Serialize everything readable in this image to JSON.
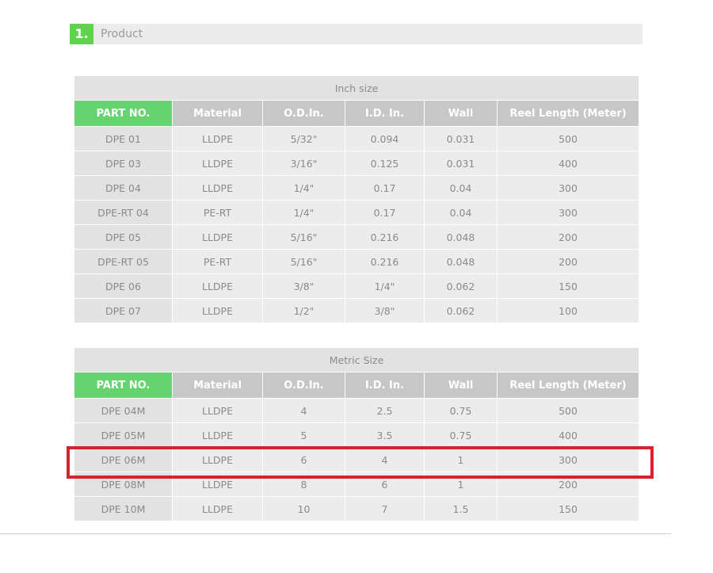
{
  "section": {
    "number": "1.",
    "title": "Product"
  },
  "columns": [
    "PART NO.",
    "Material",
    "O.D.In.",
    "I.D. In.",
    "Wall",
    "Reel Length (Meter)"
  ],
  "inch_table": {
    "caption": "Inch size",
    "rows": [
      [
        "DPE 01",
        "LLDPE",
        "5/32\"",
        "0.094",
        "0.031",
        "500"
      ],
      [
        "DPE 03",
        "LLDPE",
        "3/16\"",
        "0.125",
        "0.031",
        "400"
      ],
      [
        "DPE 04",
        "LLDPE",
        "1/4\"",
        "0.17",
        "0.04",
        "300"
      ],
      [
        "DPE-RT 04",
        "PE-RT",
        "1/4\"",
        "0.17",
        "0.04",
        "300"
      ],
      [
        "DPE 05",
        "LLDPE",
        "5/16\"",
        "0.216",
        "0.048",
        "200"
      ],
      [
        "DPE-RT 05",
        "PE-RT",
        "5/16\"",
        "0.216",
        "0.048",
        "200"
      ],
      [
        "DPE 06",
        "LLDPE",
        "3/8\"",
        "1/4\"",
        "0.062",
        "150"
      ],
      [
        "DPE 07",
        "LLDPE",
        "1/2\"",
        "3/8\"",
        "0.062",
        "100"
      ]
    ]
  },
  "metric_table": {
    "caption": "Metric Size",
    "rows": [
      [
        "DPE 04M",
        "LLDPE",
        "4",
        "2.5",
        "0.75",
        "500"
      ],
      [
        "DPE 05M",
        "LLDPE",
        "5",
        "3.5",
        "0.75",
        "400"
      ],
      [
        "DPE 06M",
        "LLDPE",
        "6",
        "4",
        "1",
        "300"
      ],
      [
        "DPE 08M",
        "LLDPE",
        "8",
        "6",
        "1",
        "200"
      ],
      [
        "DPE 10M",
        "LLDPE",
        "10",
        "7",
        "1.5",
        "150"
      ]
    ]
  },
  "highlighted_row": "DPE 06M",
  "colors": {
    "accent_green": "#5fd34c",
    "part_header_green": "#66d46e",
    "header_gray": "#c7c7c7",
    "highlight_red": "#d5232f"
  }
}
